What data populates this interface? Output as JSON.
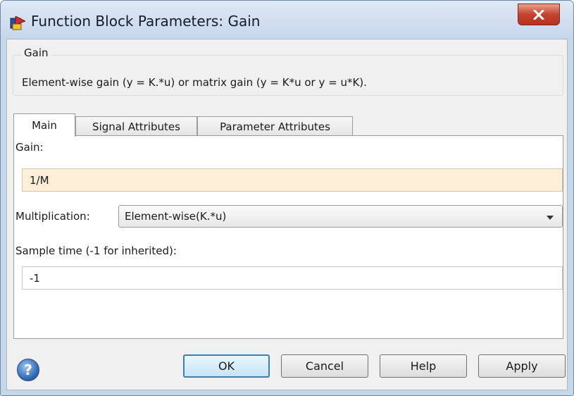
{
  "window": {
    "title": "Function Block Parameters: Gain"
  },
  "icons": {
    "app": "simulink-block-icon",
    "close": "close-x-icon",
    "help": "help-question-icon",
    "dropdown": "chevron-down-icon"
  },
  "group": {
    "legend": "Gain",
    "description": "Element-wise gain (y = K.*u) or matrix gain (y = K*u or y = u*K)."
  },
  "tabs": [
    {
      "label": "Main",
      "active": true
    },
    {
      "label": "Signal Attributes",
      "active": false
    },
    {
      "label": "Parameter Attributes",
      "active": false
    }
  ],
  "main": {
    "gain_label": "Gain:",
    "gain_value": "1/M",
    "multiplication_label": "Multiplication:",
    "multiplication_value": "Element-wise(K.*u)",
    "sample_time_label": "Sample time (-1 for inherited):",
    "sample_time_value": "-1"
  },
  "buttons": {
    "ok": "OK",
    "cancel": "Cancel",
    "help": "Help",
    "apply": "Apply"
  },
  "colors": {
    "highlight_field": "#fdefd7",
    "close_button": "#c5432f",
    "default_button_border": "#3c7fb1"
  }
}
